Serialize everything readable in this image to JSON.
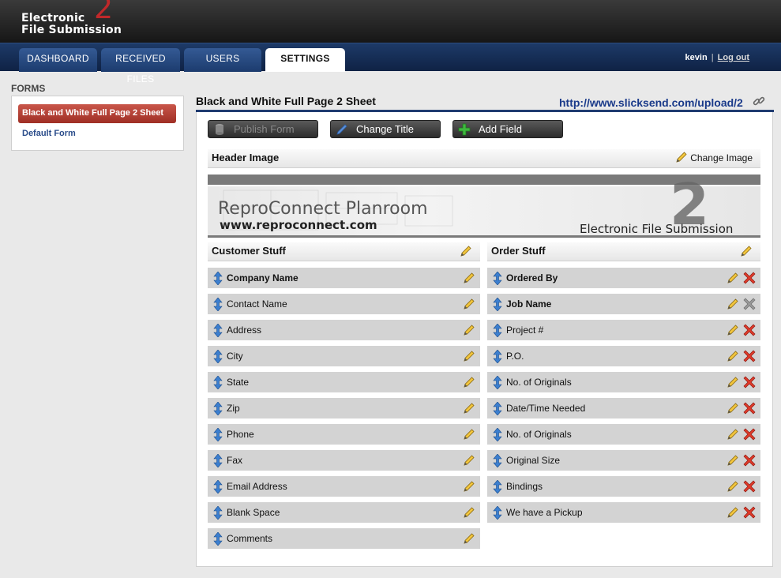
{
  "app": {
    "logo_line1": "Electronic",
    "logo_line2": "File Submission",
    "logo_number": "2"
  },
  "nav": {
    "tabs": [
      {
        "label": "DASHBOARD"
      },
      {
        "label": "RECEIVED FILES"
      },
      {
        "label": "USERS"
      },
      {
        "label": "SETTINGS"
      }
    ],
    "active_tab": "SETTINGS",
    "username": "kevin",
    "separator": "|",
    "logout": "Log out"
  },
  "sidebar": {
    "title": "FORMS",
    "forms": [
      {
        "label": "Black and White Full Page 2 Sheet"
      },
      {
        "label": "Default Form"
      }
    ]
  },
  "main": {
    "title": "Black and White Full Page 2 Sheet",
    "url": "http://www.slicksend.com/upload/2",
    "toolbar": {
      "publish": "Publish Form",
      "change_title": "Change Title",
      "add_field": "Add Field"
    },
    "header_image": {
      "label": "Header Image",
      "change": "Change Image",
      "banner_title": "ReproConnect Planroom",
      "banner_url": "www.reproconnect.com",
      "banner_sub": "Electronic File Submission",
      "banner_number": "2"
    },
    "customer": {
      "title": "Customer Stuff",
      "fields": [
        {
          "label": "Company Name",
          "bold": true
        },
        {
          "label": "Contact Name",
          "bold": false
        },
        {
          "label": "Address",
          "bold": false
        },
        {
          "label": "City",
          "bold": false
        },
        {
          "label": "State",
          "bold": false
        },
        {
          "label": "Zip",
          "bold": false
        },
        {
          "label": "Phone",
          "bold": false
        },
        {
          "label": "Fax",
          "bold": false
        },
        {
          "label": "Email Address",
          "bold": false
        },
        {
          "label": "Blank Space",
          "bold": false
        },
        {
          "label": "Comments",
          "bold": false
        }
      ]
    },
    "order": {
      "title": "Order Stuff",
      "fields": [
        {
          "label": "Ordered By",
          "bold": true,
          "deletable": true
        },
        {
          "label": "Job Name",
          "bold": true,
          "deletable": false
        },
        {
          "label": "Project #",
          "bold": false,
          "deletable": true
        },
        {
          "label": "P.O.",
          "bold": false,
          "deletable": true
        },
        {
          "label": "No. of Originals",
          "bold": false,
          "deletable": true
        },
        {
          "label": "Date/Time Needed",
          "bold": false,
          "deletable": true
        },
        {
          "label": "No. of Originals",
          "bold": false,
          "deletable": true
        },
        {
          "label": "Original Size",
          "bold": false,
          "deletable": true
        },
        {
          "label": "Bindings",
          "bold": false,
          "deletable": true
        },
        {
          "label": "We have a Pickup",
          "bold": false,
          "deletable": true
        }
      ]
    }
  },
  "colors": {
    "nav": "#1d3a68",
    "active_form": "#b4433a",
    "link": "#1a3a8a",
    "field_bg": "#d3d3d3"
  }
}
